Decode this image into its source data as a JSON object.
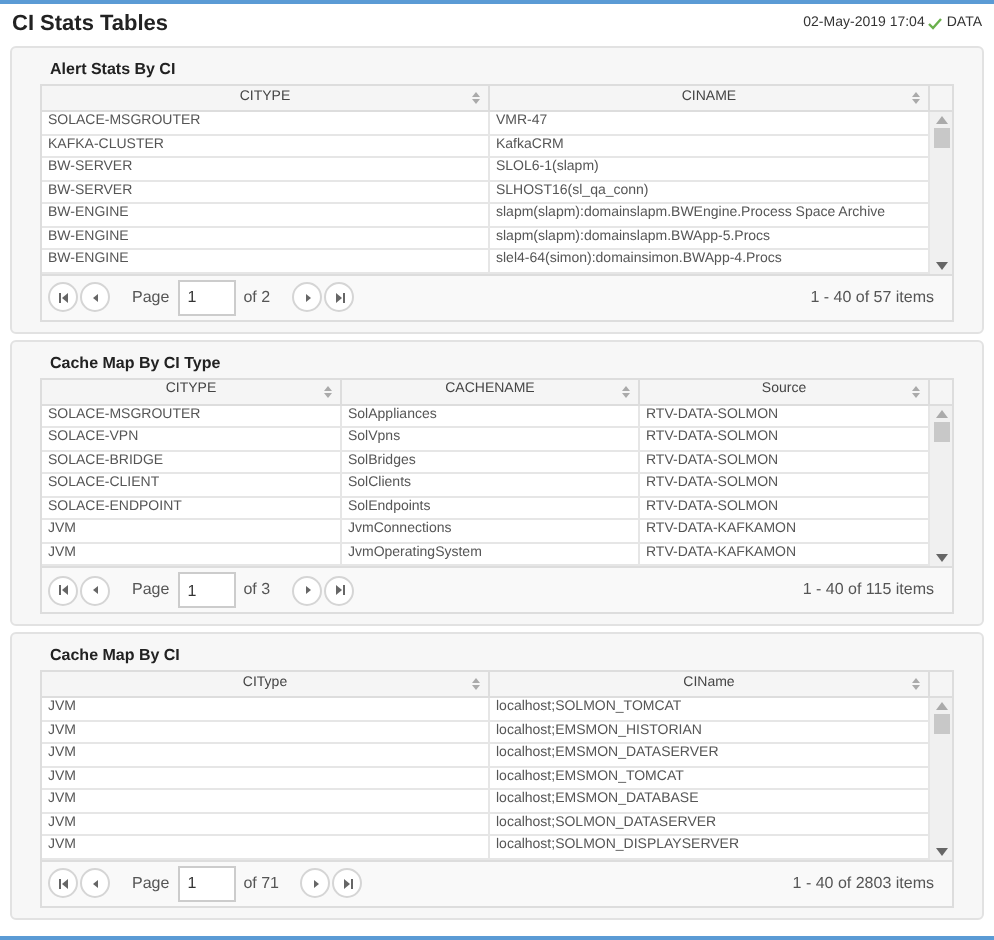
{
  "title": "CI Stats Tables",
  "timestamp": "02-May-2019 17:04",
  "status": {
    "label": "DATA",
    "ok": true
  },
  "tables": [
    {
      "title": "Alert Stats By CI",
      "columns": [
        "CITYPE",
        "CINAME"
      ],
      "rows": [
        [
          "SOLACE-MSGROUTER",
          "VMR-47"
        ],
        [
          "KAFKA-CLUSTER",
          "KafkaCRM"
        ],
        [
          "BW-SERVER",
          "SLOL6-1(slapm)"
        ],
        [
          "BW-SERVER",
          "SLHOST16(sl_qa_conn)"
        ],
        [
          "BW-ENGINE",
          "slapm(slapm):domainslapm.BWEngine.Process Space Archive"
        ],
        [
          "BW-ENGINE",
          "slapm(slapm):domainslapm.BWApp-5.Procs"
        ],
        [
          "BW-ENGINE",
          "slel4-64(simon):domainsimon.BWApp-4.Procs"
        ]
      ],
      "pager": {
        "page_label": "Page",
        "page": "1",
        "of": "of 2",
        "summary": "1 - 40 of 57 items"
      }
    },
    {
      "title": "Cache Map By CI Type",
      "columns": [
        "CITYPE",
        "CACHENAME",
        "Source"
      ],
      "rows": [
        [
          "SOLACE-MSGROUTER",
          "SolAppliances",
          "RTV-DATA-SOLMON"
        ],
        [
          "SOLACE-VPN",
          "SolVpns",
          "RTV-DATA-SOLMON"
        ],
        [
          "SOLACE-BRIDGE",
          "SolBridges",
          "RTV-DATA-SOLMON"
        ],
        [
          "SOLACE-CLIENT",
          "SolClients",
          "RTV-DATA-SOLMON"
        ],
        [
          "SOLACE-ENDPOINT",
          "SolEndpoints",
          "RTV-DATA-SOLMON"
        ],
        [
          "JVM",
          "JvmConnections",
          "RTV-DATA-KAFKAMON"
        ],
        [
          "JVM",
          "JvmOperatingSystem",
          "RTV-DATA-KAFKAMON"
        ]
      ],
      "pager": {
        "page_label": "Page",
        "page": "1",
        "of": "of 3",
        "summary": "1 - 40 of 115 items"
      }
    },
    {
      "title": "Cache Map By CI",
      "columns": [
        "CIType",
        "CIName"
      ],
      "rows": [
        [
          "JVM",
          "localhost;SOLMON_TOMCAT"
        ],
        [
          "JVM",
          "localhost;EMSMON_HISTORIAN"
        ],
        [
          "JVM",
          "localhost;EMSMON_DATASERVER"
        ],
        [
          "JVM",
          "localhost;EMSMON_TOMCAT"
        ],
        [
          "JVM",
          "localhost;EMSMON_DATABASE"
        ],
        [
          "JVM",
          "localhost;SOLMON_DATASERVER"
        ],
        [
          "JVM",
          "localhost;SOLMON_DISPLAYSERVER"
        ]
      ],
      "pager": {
        "page_label": "Page",
        "page": "1",
        "of": "of 71",
        "summary": "1 - 40 of 2803 items"
      }
    }
  ]
}
